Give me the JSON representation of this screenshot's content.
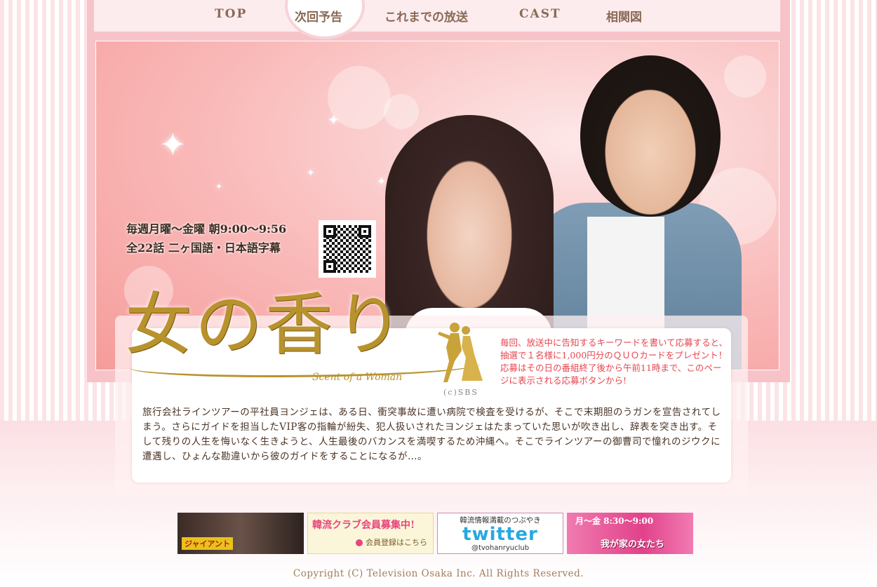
{
  "nav": {
    "items": [
      "TOP",
      "次回予告",
      "これまでの放送",
      "CAST",
      "相関図"
    ]
  },
  "hero": {
    "schedule_line1": "毎週月曜～金曜 朝9:00～9:56",
    "schedule_line2": "全22話 二ヶ国語・日本語字幕"
  },
  "logo": {
    "title": "女の香り",
    "subtitle": "Scent of a Woman",
    "credit": "(c)SBS"
  },
  "campaign": {
    "text": "毎回、放送中に告知するキーワードを書いて応募すると、抽選で１名様に1,000円分のＱＵＯカードをプレゼント！\n応募はその日の番組終了後から午前11時まで、このページに表示される応募ボタンから!"
  },
  "synopsis": {
    "text": "旅行会社ラインツアーの平社員ヨンジェは、ある日、衝突事故に遭い病院で検査を受けるが、そこで末期胆のうガンを宣告されてしまう。さらにガイドを担当したVIP客の指輪が紛失、犯人扱いされたヨンジェはたまっていた思いが吹き出し、辞表を突き出す。そして残りの人生を悔いなく生きようと、人生最後のバカンスを満喫するため沖縄へ。そこでラインツアーの御曹司で憧れのジウクに遭遇し、ひょんな勘違いから彼のガイドをすることになるが…。"
  },
  "banners": {
    "giant_label": "ジャイアント",
    "club_title": "韓流クラブ会員募集中!",
    "club_sub": "会員登録はこちら",
    "twitter_top": "韓流情報満載のつぶやき",
    "twitter_logo": "twitter",
    "twitter_handle": "@tvohanryuclub",
    "drama_time": "月～金 8:30～9:00",
    "drama_title": "我が家の女たち"
  },
  "footer": {
    "copyright": "Copyright (C) Television Osaka Inc. All Rights Reserved."
  },
  "colors": {
    "nav_text": "#8a6a55",
    "campaign_text": "#e6454f",
    "logo_gold": "#b8922c",
    "twitter_blue": "#27a8e0"
  }
}
